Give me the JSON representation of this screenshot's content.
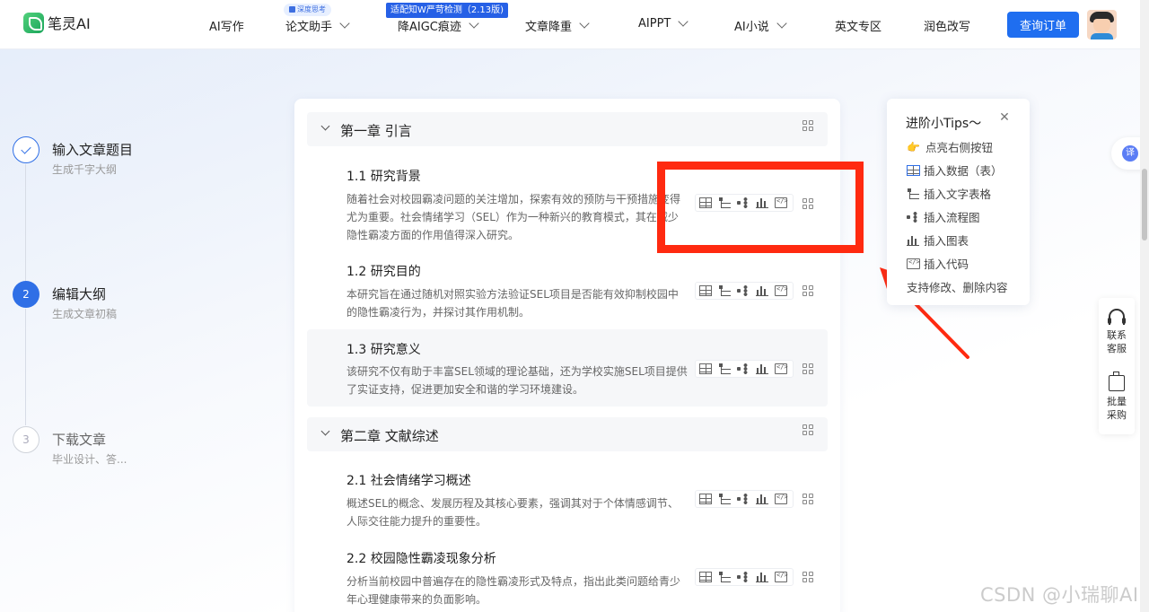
{
  "header": {
    "logo_text": "笔灵AI",
    "nav": [
      {
        "label": "AI写作",
        "has_dropdown": false
      },
      {
        "label": "论文助手",
        "has_dropdown": true,
        "badge": "深度思考"
      },
      {
        "label": "降AIGC痕迹",
        "has_dropdown": true,
        "badge": "适配知W严苛检测（2.13版)"
      },
      {
        "label": "文章降重",
        "has_dropdown": true
      },
      {
        "label": "AIPPT",
        "has_dropdown": true
      },
      {
        "label": "AI小说",
        "has_dropdown": true
      },
      {
        "label": "英文专区",
        "has_dropdown": false
      },
      {
        "label": "润色改写",
        "has_dropdown": false
      }
    ],
    "order_button": "查询订单"
  },
  "steps": [
    {
      "number": "1",
      "title": "输入文章题目",
      "subtitle": "生成千字大纲",
      "state": "done"
    },
    {
      "number": "2",
      "title": "编辑大纲",
      "subtitle": "生成文章初稿",
      "state": "active"
    },
    {
      "number": "3",
      "title": "下载文章",
      "subtitle": "毕业设计、答...",
      "state": "todo"
    }
  ],
  "outline": {
    "chapters": [
      {
        "title": "第一章 引言",
        "sections": [
          {
            "title": "1.1 研究背景",
            "desc": "随着社会对校园霸凌问题的关注增加，探索有效的预防与干预措施变得尤为重要。社会情绪学习（SEL）作为一种新兴的教育模式，其在减少隐性霸凌方面的作用值得深入研究。",
            "highlighted": false
          },
          {
            "title": "1.2 研究目的",
            "desc": "本研究旨在通过随机对照实验方法验证SEL项目是否能有效抑制校园中的隐性霸凌行为，并探讨其作用机制。",
            "highlighted": false
          },
          {
            "title": "1.3 研究意义",
            "desc": "该研究不仅有助于丰富SEL领域的理论基础，还为学校实施SEL项目提供了实证支持，促进更加安全和谐的学习环境建设。",
            "highlighted": true
          }
        ]
      },
      {
        "title": "第二章 文献综述",
        "sections": [
          {
            "title": "2.1 社会情绪学习概述",
            "desc": "概述SEL的概念、发展历程及其核心要素，强调其对于个体情感调节、人际交往能力提升的重要性。",
            "highlighted": false
          },
          {
            "title": "2.2 校园隐性霸凌现象分析",
            "desc": "分析当前校园中普遍存在的隐性霸凌形式及特点，指出此类问题给青少年心理健康带来的负面影响。",
            "highlighted": false
          }
        ]
      }
    ]
  },
  "tips": {
    "title": "进阶小Tips～",
    "intro": "点亮右侧按钮",
    "items": [
      {
        "icon": "table-icon",
        "label": "插入数据（表）"
      },
      {
        "icon": "text-table-icon",
        "label": "插入文字表格"
      },
      {
        "icon": "flowchart-icon",
        "label": "插入流程图"
      },
      {
        "icon": "bar-chart-icon",
        "label": "插入图表"
      },
      {
        "icon": "code-icon",
        "label": "插入代码"
      }
    ],
    "footer": "支持修改、删除内容"
  },
  "side_widgets": {
    "translate_label": "译",
    "contact_label": "联系客服",
    "bulk_label": "批量采购"
  },
  "watermark": "CSDN @小瑞聊AI",
  "colors": {
    "accent": "#1f6ef0",
    "highlight_red": "#ff2a10"
  }
}
